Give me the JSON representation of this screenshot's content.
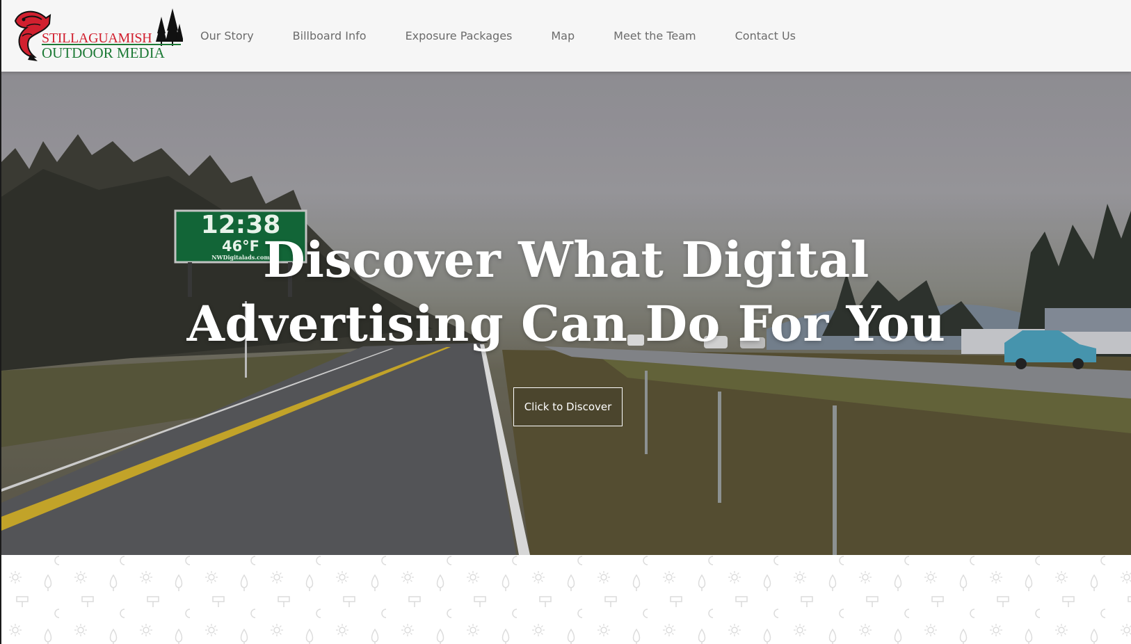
{
  "brand": {
    "line1": "STILLAGUAMISH",
    "line2": "OUTDOOR MEDIA",
    "primary_red": "#d1202f",
    "primary_green": "#1d7a36",
    "logo_icons": [
      "salmon-icon",
      "pine-trees-icon"
    ]
  },
  "nav": {
    "items": [
      {
        "label": "Our Story"
      },
      {
        "label": "Billboard Info"
      },
      {
        "label": "Exposure Packages"
      },
      {
        "label": "Map"
      },
      {
        "label": "Meet the Team"
      },
      {
        "label": "Contact Us"
      }
    ]
  },
  "hero": {
    "title_line1": "Discover What Digital",
    "title_line2": "Advertising Can Do For You",
    "cta_label": "Click to Discover",
    "billboard": {
      "time": "12:38",
      "temperature": "46°F",
      "site": "NWDigitalads.com"
    }
  },
  "pattern": {
    "icons": [
      "sun-icon",
      "tree-icon",
      "billboard-icon",
      "moon-icon"
    ],
    "color": "#dcdcdc"
  }
}
